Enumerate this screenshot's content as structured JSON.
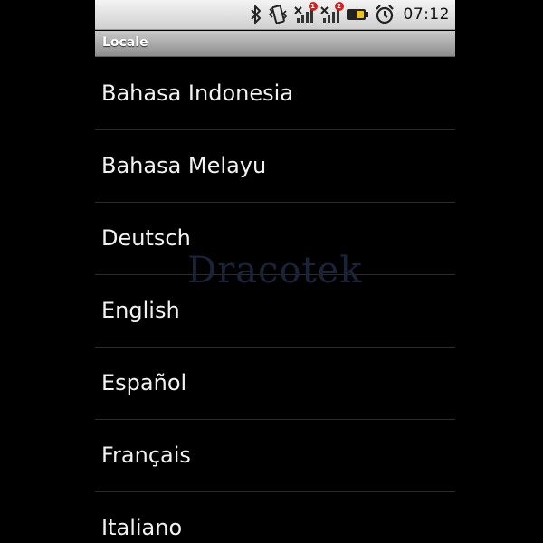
{
  "status_bar": {
    "time": "07:12",
    "signal_1_badge": "1",
    "signal_2_badge": "2",
    "icons": [
      "bluetooth-icon",
      "vibrate-icon",
      "signal-sim1-icon",
      "signal-sim2-icon",
      "battery-icon",
      "alarm-icon"
    ]
  },
  "title_bar": {
    "title": "Locale"
  },
  "locales": [
    {
      "label": "Bahasa Indonesia"
    },
    {
      "label": "Bahasa Melayu"
    },
    {
      "label": "Deutsch"
    },
    {
      "label": "English"
    },
    {
      "label": "Español"
    },
    {
      "label": "Français"
    },
    {
      "label": "Italiano"
    }
  ],
  "watermark": "Dracotek",
  "colors": {
    "background": "#000000",
    "status_bar": "#e6e6e6",
    "title_bar": "#a8a8a8",
    "item_text": "#f2f2f2",
    "divider": "#2c2c2c"
  }
}
